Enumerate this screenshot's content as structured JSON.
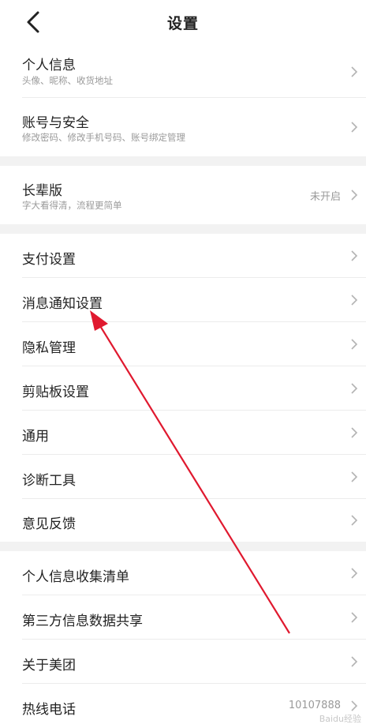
{
  "header": {
    "title": "设置"
  },
  "sections": [
    {
      "items": [
        {
          "key": "personal-info",
          "label": "个人信息",
          "sub": "头像、昵称、收货地址"
        },
        {
          "key": "account-security",
          "label": "账号与安全",
          "sub": "修改密码、修改手机号码、账号绑定管理"
        }
      ]
    },
    {
      "items": [
        {
          "key": "elder-mode",
          "label": "长辈版",
          "sub": "字大看得清，流程更简单",
          "value": "未开启"
        }
      ]
    },
    {
      "items": [
        {
          "key": "payment-settings",
          "label": "支付设置"
        },
        {
          "key": "notification-settings",
          "label": "消息通知设置"
        },
        {
          "key": "privacy-management",
          "label": "隐私管理"
        },
        {
          "key": "clipboard-settings",
          "label": "剪贴板设置"
        },
        {
          "key": "general",
          "label": "通用"
        },
        {
          "key": "diagnostic-tools",
          "label": "诊断工具"
        },
        {
          "key": "feedback",
          "label": "意见反馈"
        }
      ]
    },
    {
      "items": [
        {
          "key": "personal-info-list",
          "label": "个人信息收集清单"
        },
        {
          "key": "third-party-sharing",
          "label": "第三方信息数据共享"
        },
        {
          "key": "about-meituan",
          "label": "关于美团"
        },
        {
          "key": "hotline",
          "label": "热线电话",
          "value": "10107888"
        }
      ]
    }
  ],
  "watermark": "Baidu经验",
  "colors": {
    "annotation_arrow": "#e0192f",
    "section_gap": "#f2f2f2",
    "primary_text": "#222222",
    "secondary_text": "#9a9a9a"
  },
  "icons": {
    "back": "chevron-left-icon",
    "row_chevron": "chevron-right-icon"
  }
}
